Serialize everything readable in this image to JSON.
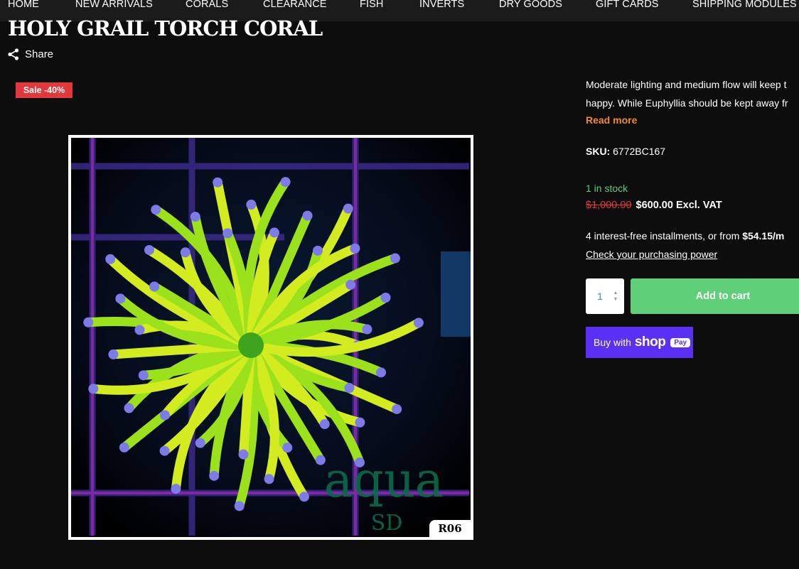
{
  "nav": {
    "items": [
      "HOME",
      "NEW ARRIVALS",
      "CORALS",
      "CLEARANCE",
      "FISH",
      "INVERTS",
      "DRY GOODS",
      "GIFT CARDS",
      "SHIPPING MODULES"
    ]
  },
  "product": {
    "title": "HOLY GRAIL TORCH CORAL",
    "share_label": "Share",
    "sale_badge": "Sale -40%",
    "image_tag": "R06",
    "watermark_line1": "aqua",
    "watermark_line2": "SD",
    "description_line1": "Moderate lighting and medium flow will keep t",
    "description_line2": "happy. While Euphyllia should be kept away fr",
    "read_more": "Read more",
    "sku_label": "SKU:",
    "sku_value": "6772BC167",
    "stock": "1 in stock",
    "old_price": "$1,000.00",
    "new_price": "$600.00 Excl. VAT",
    "installments_text": "4 interest-free installments, or from ",
    "installments_amount": "$54.15/m",
    "purchasing_power": "Check your purchasing power",
    "quantity": "1",
    "add_to_cart": "Add to cart",
    "buy_with": "Buy with",
    "shop_word": "shop",
    "pay_word": "Pay"
  },
  "colors": {
    "background": "#0d0d0d",
    "nav_background": "#1b1b1b",
    "sale_red": "#e2373b",
    "stock_green": "#5fcf7a",
    "read_more_orange": "#f08a2e",
    "shop_pay_purple": "#5a31f4"
  },
  "icons": {
    "share": "share-icon"
  }
}
